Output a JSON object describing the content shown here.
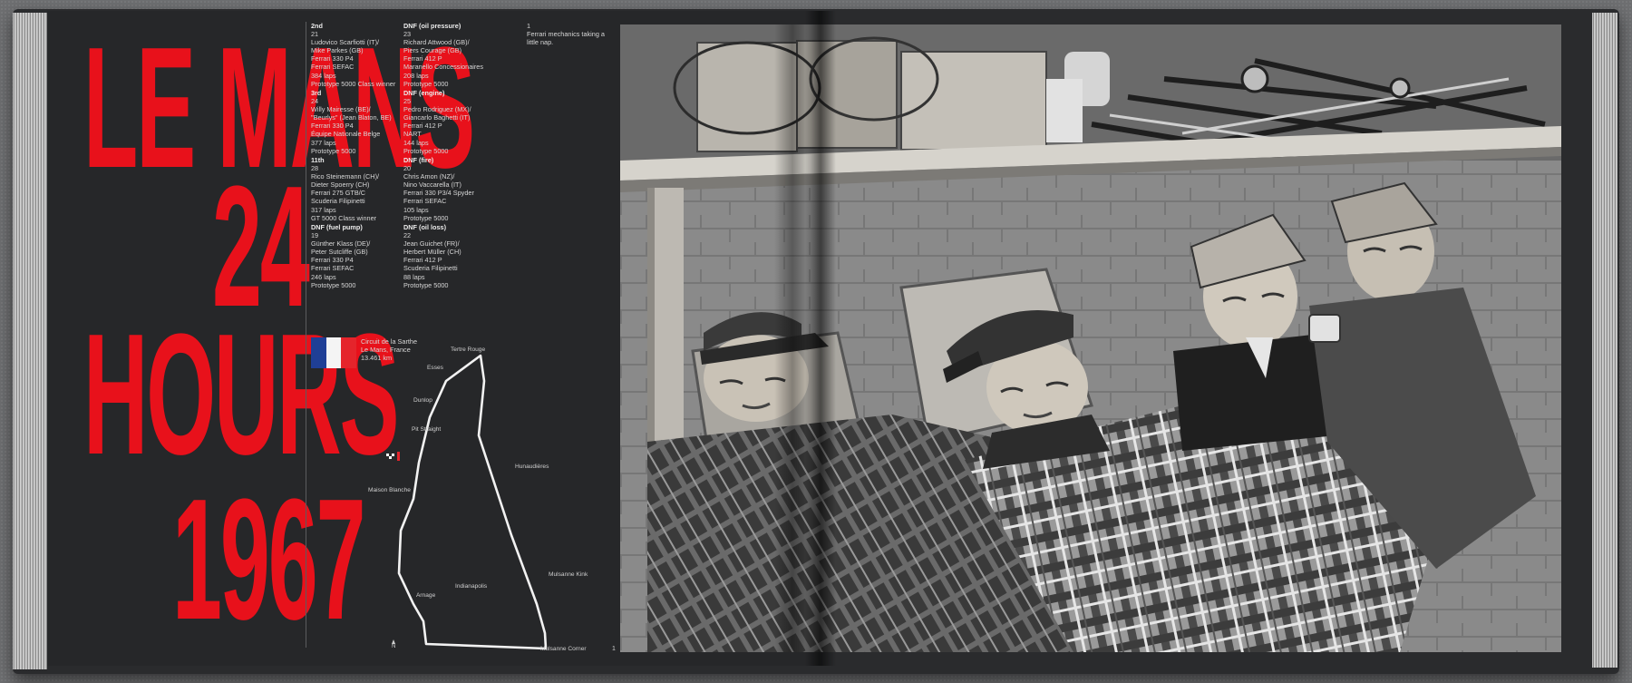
{
  "title": {
    "line1": "LE MANS",
    "line2": "24",
    "line3": "HOURS",
    "line4": "1967"
  },
  "results": [
    {
      "heading": "2nd",
      "lines": [
        "21",
        "Ludovico Scarfiotti (IT)/",
        "Mike Parkes (GB)",
        "Ferrari 330 P4",
        "Ferrari SEFAC",
        "384 laps",
        "Prototype 5000 Class winner"
      ]
    },
    {
      "heading": "3rd",
      "lines": [
        "24",
        "Willy Mairesse (BE)/",
        "\"Beurlys\" (Jean Blaton, BE)",
        "Ferrari 330 P4",
        "Équipe Nationale Belge",
        "377 laps",
        "Prototype 5000"
      ]
    },
    {
      "heading": "11th",
      "lines": [
        "28",
        "Rico Steinemann (CH)/",
        "Dieter Spoerry (CH)",
        "Ferrari 275 GTB/C",
        "Scuderia Filipinetti",
        "317 laps",
        "GT 5000 Class winner"
      ]
    },
    {
      "heading": "DNF (fuel pump)",
      "lines": [
        "19",
        "Günther Klass (DE)/",
        "Peter Sutcliffe (GB)",
        "Ferrari 330 P4",
        "Ferrari SEFAC",
        "246 laps",
        "Prototype 5000"
      ]
    },
    {
      "heading": "DNF (oil pressure)",
      "lines": [
        "23",
        "Richard Attwood (GB)/",
        "Piers Courage (GB)",
        "Ferrari 412 P",
        "Maranello Concessionaires",
        "208 laps",
        "Prototype 5000"
      ]
    },
    {
      "heading": "DNF (engine)",
      "lines": [
        "25",
        "Pedro Rodriguez (MX)/",
        "Giancarlo Baghetti (IT)",
        "Ferrari 412 P",
        "NART",
        "144 laps",
        "Prototype 5000"
      ]
    },
    {
      "heading": "DNF (fire)",
      "lines": [
        "20",
        "Chris Amon (NZ)/",
        "Nino Vaccarella (IT)",
        "Ferrari 330 P3/4 Spyder",
        "Ferrari SEFAC",
        "105 laps",
        "Prototype 5000"
      ]
    },
    {
      "heading": "DNF (oil loss)",
      "lines": [
        "22",
        "Jean Guichet (FR)/",
        "Herbert Müller (CH)",
        "Ferrari 412 P",
        "Scuderia Filipinetti",
        "88 laps",
        "Prototype 5000"
      ]
    }
  ],
  "caption": {
    "number": "1",
    "text": "Ferrari mechanics taking a little nap."
  },
  "circuit": {
    "name": "Circuit de la Sarthe",
    "location": "Le Mans, France",
    "length": "13.461 km",
    "labels": {
      "tertre_rouge": "Tertre Rouge",
      "esses": "Esses",
      "dunlop": "Dunlop",
      "pit_straight": "Pit Straight",
      "hunaudieres": "Hunaudières",
      "maison_blanche": "Maison Blanche",
      "mulsanne_kink": "Mulsanne Kink",
      "indianapolis": "Indianapolis",
      "arnage": "Arnage",
      "mulsanne_corner": "Mulsanne Corner"
    },
    "north": "N"
  },
  "page_number": "1",
  "colors": {
    "accent_red": "#e8111b",
    "flag_blue": "#1f3f96",
    "flag_white": "#f4f4f4",
    "flag_red": "#e5242b",
    "page_bg": "#262729"
  },
  "icons": {
    "flag": "france-flag-icon",
    "north_arrow": "north-arrow-icon",
    "start_finish": "checkered-flag-icon"
  }
}
